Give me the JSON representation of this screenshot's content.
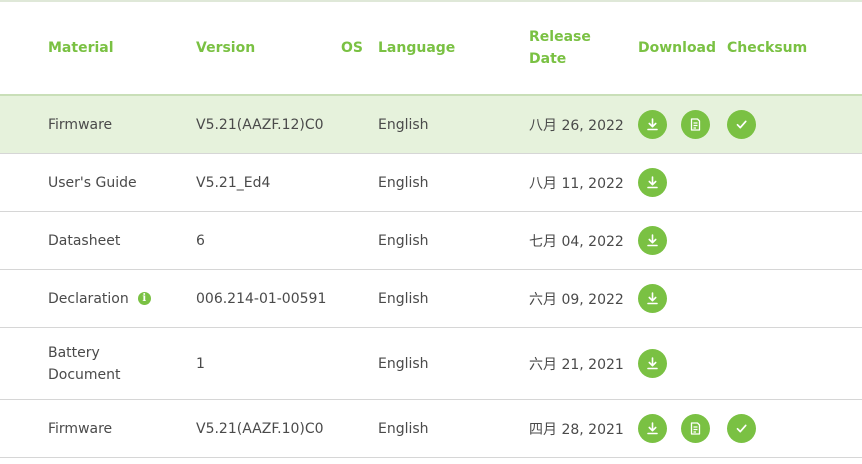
{
  "header": {
    "material": "Material",
    "version": "Version",
    "os": "OS",
    "language": "Language",
    "release_date_1": "Release",
    "release_date_2": "Date",
    "download": "Download",
    "checksum": "Checksum"
  },
  "rows": [
    {
      "material": "Firmware",
      "version": "V5.21(AAZF.12)C0",
      "language": "English",
      "date": "八月 26, 2022",
      "has_notes": true,
      "has_checksum": true
    },
    {
      "material": "User's Guide",
      "version": "V5.21_Ed4",
      "language": "English",
      "date": "八月 11, 2022"
    },
    {
      "material": "Datasheet",
      "version": "6",
      "language": "English",
      "date": "七月 04, 2022"
    },
    {
      "material": "Declaration",
      "version": "006.214-01-00591",
      "language": "English",
      "date": "六月 09, 2022",
      "info": "i"
    },
    {
      "material_1": "Battery",
      "material_2": "Document",
      "version": "1",
      "language": "English",
      "date": "六月 21, 2021"
    },
    {
      "material": "Firmware",
      "version": "V5.21(AAZF.10)C0",
      "language": "English",
      "date": "四月 28, 2021",
      "has_notes": true,
      "has_checksum": true
    }
  ],
  "colors": {
    "accent": "#7ac143",
    "highlight_row": "#e6f2dc"
  },
  "icons": {
    "download": "download-icon",
    "notes": "release-note-icon",
    "checksum": "check-icon",
    "info": "info-icon"
  }
}
